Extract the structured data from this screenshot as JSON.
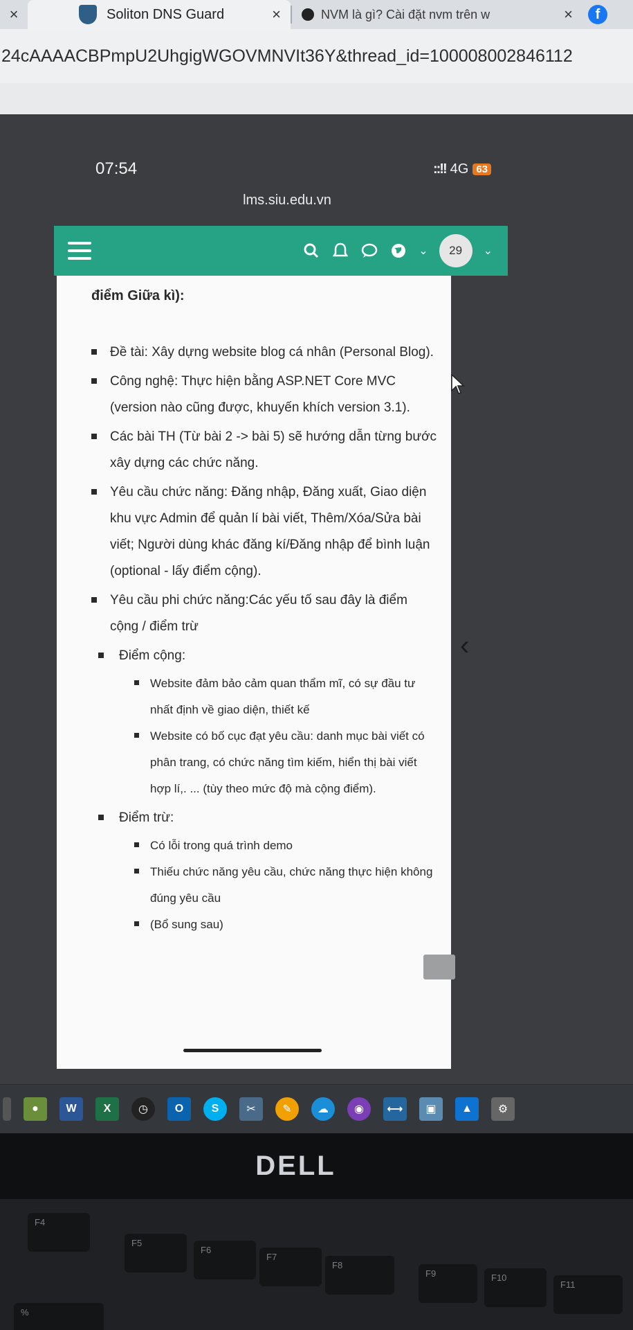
{
  "browser": {
    "lead_close": "×",
    "tabs": [
      {
        "title": "Soliton DNS Guard",
        "close": "×",
        "active": true
      },
      {
        "title": "NVM là gì? Cài đặt nvm trên w",
        "close": "×",
        "active": false
      }
    ],
    "address": "24cAAAACBPmpU2UhgigWGOVMNVIt36Y&thread_id=10000800284611​2"
  },
  "phone": {
    "time": "07:54",
    "network": "4G",
    "battery": "63",
    "domain": "lms.siu.edu.vn"
  },
  "appbar": {
    "avatar_text": "29",
    "colors": {
      "bar": "#26a285",
      "background": "#fafafa"
    }
  },
  "content": {
    "heading": "điểm Giữa kì):",
    "items": [
      {
        "text": "Đề tài: Xây dựng website blog cá nhân (Personal Blog)."
      },
      {
        "text": "Công nghệ: Thực hiện bằng ASP.NET Core MVC (version nào cũng được, khuyến khích version 3.1)."
      },
      {
        "text": "Các bài TH (Từ bài 2 -> bài 5) sẽ hướng dẫn từng bước xây dựng các chức năng."
      },
      {
        "text": "Yêu cầu chức năng: Đăng nhập, Đăng xuất, Giao diện khu vực Admin để quản lí bài viết, Thêm/Xóa/Sửa bài viết; Người dùng khác đăng kí/Đăng nhập để bình luận (optional - lấy điểm cộng)."
      },
      {
        "text": "Yêu cầu phi chức năng:Các yếu tố sau đây là điểm cộng / điểm trừ"
      }
    ],
    "plus": {
      "label": "Điểm cộng:",
      "items": [
        "Website đảm bảo cảm quan thẩm mĩ, có sự đầu tư nhất định về giao diện, thiết kế",
        "Website có bố cục đạt yêu cầu: danh mục bài viết có phân trang, có chức năng tìm kiếm, hiển thị bài viết hợp lí,. ... (tùy theo mức độ mà cộng điểm)."
      ]
    },
    "minus": {
      "label": "Điểm trừ:",
      "items": [
        "Có lỗi trong quá trình demo",
        "Thiếu chức năng yêu cầu, chức năng thực hiện không đúng yêu cầu",
        "(Bổ sung sau)"
      ]
    }
  },
  "monitor": {
    "brand": "DELL"
  },
  "keyboard": {
    "keys": [
      "F4",
      "F5",
      "F6",
      "F7",
      "F8",
      "F9",
      "F10",
      "F11",
      "%"
    ]
  }
}
